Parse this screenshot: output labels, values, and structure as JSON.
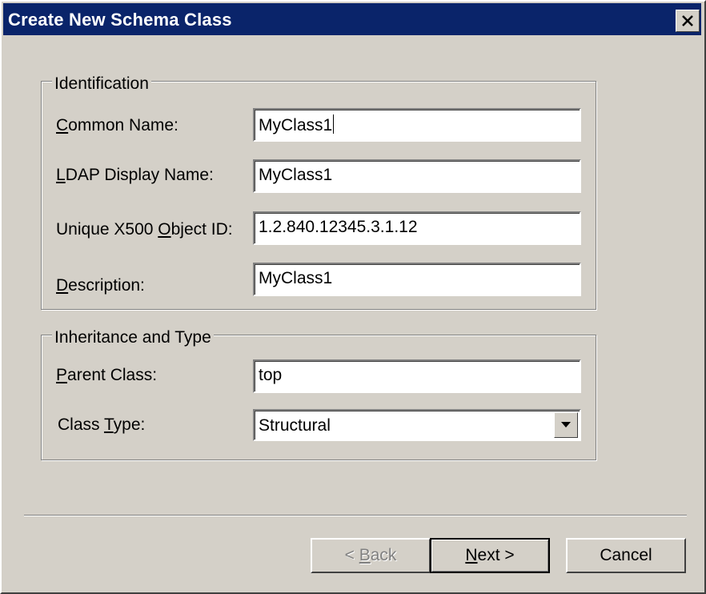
{
  "window": {
    "title": "Create New Schema Class",
    "close_icon": "close-icon"
  },
  "identification": {
    "legend": "Identification",
    "common_name": {
      "label_prefix": "",
      "label_accel": "C",
      "label_rest": "ommon Name:",
      "value": "MyClass1"
    },
    "ldap_display_name": {
      "label_prefix": "",
      "label_accel": "L",
      "label_rest": "DAP Display Name:",
      "value": "MyClass1"
    },
    "x500_oid": {
      "label_prefix": "Unique X500 ",
      "label_accel": "O",
      "label_rest": "bject ID:",
      "value": "1.2.840.12345.3.1.12"
    },
    "description": {
      "label_prefix": "",
      "label_accel": "D",
      "label_rest": "escription:",
      "value": "MyClass1"
    }
  },
  "inheritance": {
    "legend": "Inheritance and Type",
    "parent_class": {
      "label_prefix": "",
      "label_accel": "P",
      "label_rest": "arent Class:",
      "value": "top"
    },
    "class_type": {
      "label_prefix": "Class ",
      "label_accel": "T",
      "label_rest": "ype:",
      "value": "Structural",
      "dropdown_icon": "chevron-down-icon"
    }
  },
  "buttons": {
    "back": {
      "prefix": "< ",
      "accel": "B",
      "rest": "ack"
    },
    "next": {
      "prefix": "",
      "accel": "N",
      "rest": "ext >"
    },
    "cancel": {
      "label": "Cancel"
    }
  },
  "colors": {
    "title_bar": "#0a246a",
    "dialog_face": "#d4d0c8",
    "disabled_text": "#808080"
  }
}
